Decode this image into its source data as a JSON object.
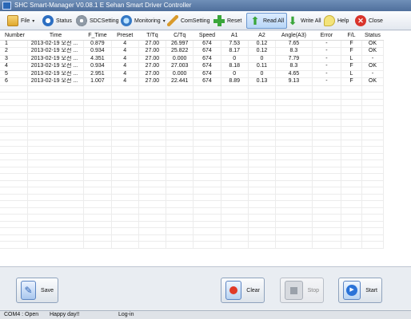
{
  "window": {
    "title": "SHC Smart-Manager   V0.08.1 E   Sehan Smart Driver Controller"
  },
  "toolbar": {
    "file": "File",
    "status": "Status",
    "sdcsetting": "SDCSetting",
    "monitoring": "Monitoring",
    "comsetting": "ComSetting",
    "reset": "Reset",
    "readall": "Read All",
    "writeall": "Write All",
    "help": "Help",
    "close": "Close"
  },
  "table": {
    "columns": [
      "Number",
      "Time",
      "F_Time",
      "Preset",
      "T/Tq",
      "C/Tq",
      "Speed",
      "A1",
      "A2",
      "Angle(A3)",
      "Error",
      "F/L",
      "Status"
    ],
    "rows": [
      [
        "1",
        "2013-02-19 오전 ...",
        "0.879",
        "4",
        "27.00",
        "26.997",
        "674",
        "7.53",
        "0.12",
        "7.65",
        "-",
        "F",
        "OK"
      ],
      [
        "2",
        "2013-02-19 오전 ...",
        "0.934",
        "4",
        "27.00",
        "25.822",
        "674",
        "8.17",
        "0.12",
        "8.3",
        "-",
        "F",
        "OK"
      ],
      [
        "3",
        "2013-02-19 오전 ...",
        "4.351",
        "4",
        "27.00",
        "0.000",
        "674",
        "0",
        "0",
        "7.79",
        "-",
        "L",
        "-"
      ],
      [
        "4",
        "2013-02-19 오전 ...",
        "0.934",
        "4",
        "27.00",
        "27.003",
        "674",
        "8.18",
        "0.11",
        "8.3",
        "-",
        "F",
        "OK"
      ],
      [
        "5",
        "2013-02-19 오전 ...",
        "2.951",
        "4",
        "27.00",
        "0.000",
        "674",
        "0",
        "0",
        "4.65",
        "-",
        "L",
        "-"
      ],
      [
        "6",
        "2013-02-19 오전 ...",
        "1.007",
        "4",
        "27.00",
        "22.441",
        "674",
        "8.89",
        "0.13",
        "9.13",
        "-",
        "F",
        "OK"
      ]
    ]
  },
  "buttons": {
    "save": "Save",
    "clear": "Clear",
    "stop": "Stop",
    "start": "Start"
  },
  "statusbar": {
    "port": "COM4 : Open",
    "message": "Happy day!!",
    "login": "Log-in"
  },
  "colors": {
    "accent": "#5b87c5",
    "reset_green": "#3aa63a",
    "close_red": "#d9342b",
    "clear_red": "#e03b28",
    "start_blue": "#2a73d8"
  }
}
